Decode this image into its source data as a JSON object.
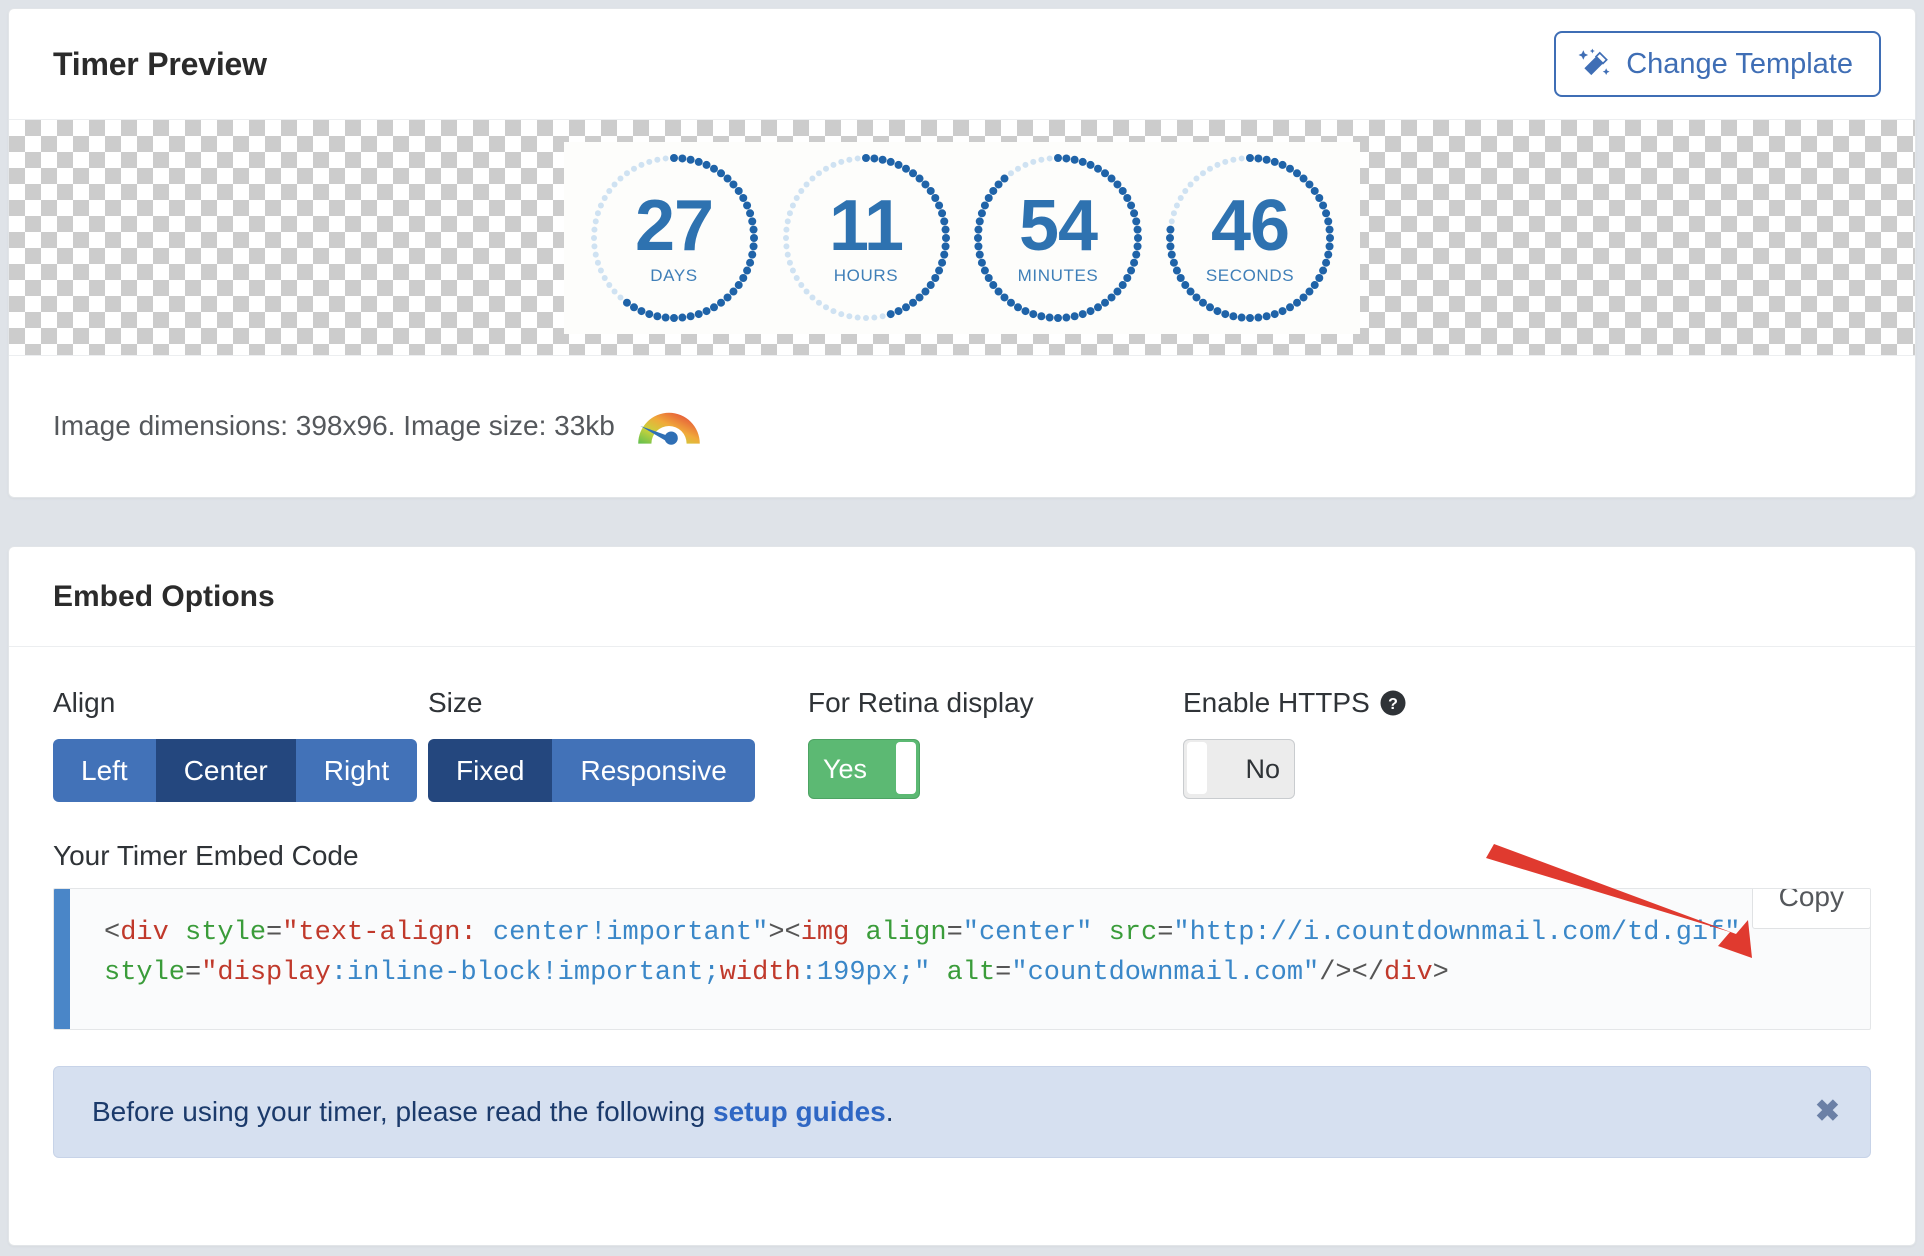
{
  "preview": {
    "title": "Timer Preview",
    "change_template_label": "Change Template",
    "change_template_icon": "magic-wand-icon",
    "meta_text": "Image dimensions: 398x96. Image size: 33kb",
    "meta_icon": "speed-gauge-icon",
    "timer": {
      "units": [
        {
          "value": "27",
          "label": "DAYS",
          "progress": 0.62
        },
        {
          "value": "11",
          "label": "HOURS",
          "progress": 0.46
        },
        {
          "value": "54",
          "label": "MINUTES",
          "progress": 0.9
        },
        {
          "value": "46",
          "label": "SECONDS",
          "progress": 0.78
        }
      ],
      "dot_color_active": "#1f63a8",
      "dot_color_inactive": "#cfe2f2",
      "digit_color": "#2e72b0"
    }
  },
  "embed": {
    "title": "Embed Options",
    "align": {
      "label": "Align",
      "options": [
        "Left",
        "Center",
        "Right"
      ],
      "selected": "Center"
    },
    "size": {
      "label": "Size",
      "options": [
        "Fixed",
        "Responsive"
      ],
      "selected": "Fixed"
    },
    "retina": {
      "label": "For Retina display",
      "value": "Yes",
      "state": "on"
    },
    "https": {
      "label": "Enable HTTPS",
      "help_icon": "question-mark-icon",
      "value": "No",
      "state": "off"
    },
    "code_label": "Your Timer Embed Code",
    "copy_label": "Copy",
    "code_line1": [
      {
        "t": "punct",
        "s": "<"
      },
      {
        "t": "tag",
        "s": "div"
      },
      {
        "t": "punct",
        "s": " "
      },
      {
        "t": "attr",
        "s": "style"
      },
      {
        "t": "punct",
        "s": "="
      },
      {
        "t": "str",
        "s": "\"text-align:"
      },
      {
        "t": "punct",
        "s": " "
      },
      {
        "t": "val",
        "s": "center!important\""
      },
      {
        "t": "punct",
        "s": "><"
      },
      {
        "t": "tag",
        "s": "img"
      },
      {
        "t": "punct",
        "s": " "
      },
      {
        "t": "attr",
        "s": "align"
      },
      {
        "t": "punct",
        "s": "="
      },
      {
        "t": "val",
        "s": "\"center\""
      },
      {
        "t": "punct",
        "s": " "
      },
      {
        "t": "attr",
        "s": "src"
      },
      {
        "t": "punct",
        "s": "="
      },
      {
        "t": "val",
        "s": "\"http://i.countdownmail.com/td.gif\""
      }
    ],
    "code_line2": [
      {
        "t": "attr",
        "s": "style"
      },
      {
        "t": "punct",
        "s": "="
      },
      {
        "t": "str",
        "s": "\"display"
      },
      {
        "t": "val",
        "s": ":inline-block!important;"
      },
      {
        "t": "str",
        "s": "width"
      },
      {
        "t": "val",
        "s": ":199px;\""
      },
      {
        "t": "punct",
        "s": " "
      },
      {
        "t": "attr",
        "s": "alt"
      },
      {
        "t": "punct",
        "s": "="
      },
      {
        "t": "val",
        "s": "\"countdownmail.com\""
      },
      {
        "t": "punct",
        "s": "/></"
      },
      {
        "t": "tag",
        "s": "div"
      },
      {
        "t": "punct",
        "s": ">"
      }
    ],
    "alert": {
      "text_before": "Before using your timer, please read the following ",
      "link": "setup guides",
      "text_after": ".",
      "close_icon": "close-x-icon"
    }
  },
  "annotation": {
    "arrow_color": "#e03a2f",
    "arrow_target": "copy-button"
  }
}
